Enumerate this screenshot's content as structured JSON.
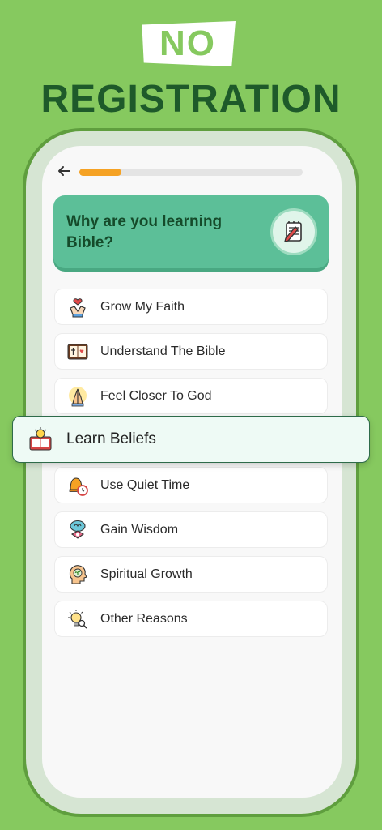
{
  "banner": {
    "badge": "NO",
    "headline": "REGISTRATION"
  },
  "header": {
    "back_icon": "arrow-left-icon",
    "progress": 0.19,
    "progress_color": "#f5a224"
  },
  "question": {
    "title": "Why are you learning Bible?",
    "icon": "notebook-pencil-icon",
    "card_color": "#5cbf98"
  },
  "options": [
    {
      "label": "Grow My Faith",
      "icon": "praying-hands-heart-icon",
      "selected": false
    },
    {
      "label": "Understand The Bible",
      "icon": "open-bible-icon",
      "selected": false
    },
    {
      "label": "Feel Closer To God",
      "icon": "praying-hands-icon",
      "selected": false
    },
    {
      "label": "Learn Beliefs",
      "icon": "book-lightbulb-icon",
      "selected": true
    },
    {
      "label": "Use Quiet Time",
      "icon": "bell-clock-icon",
      "selected": false
    },
    {
      "label": "Gain Wisdom",
      "icon": "brain-idea-icon",
      "selected": false
    },
    {
      "label": "Spiritual Growth",
      "icon": "head-sprout-icon",
      "selected": false
    },
    {
      "label": "Other Reasons",
      "icon": "lightbulb-search-icon",
      "selected": false
    }
  ],
  "colors": {
    "background": "#86c95f",
    "headline": "#1e5a2a",
    "selected_border": "#2e6b4a"
  }
}
